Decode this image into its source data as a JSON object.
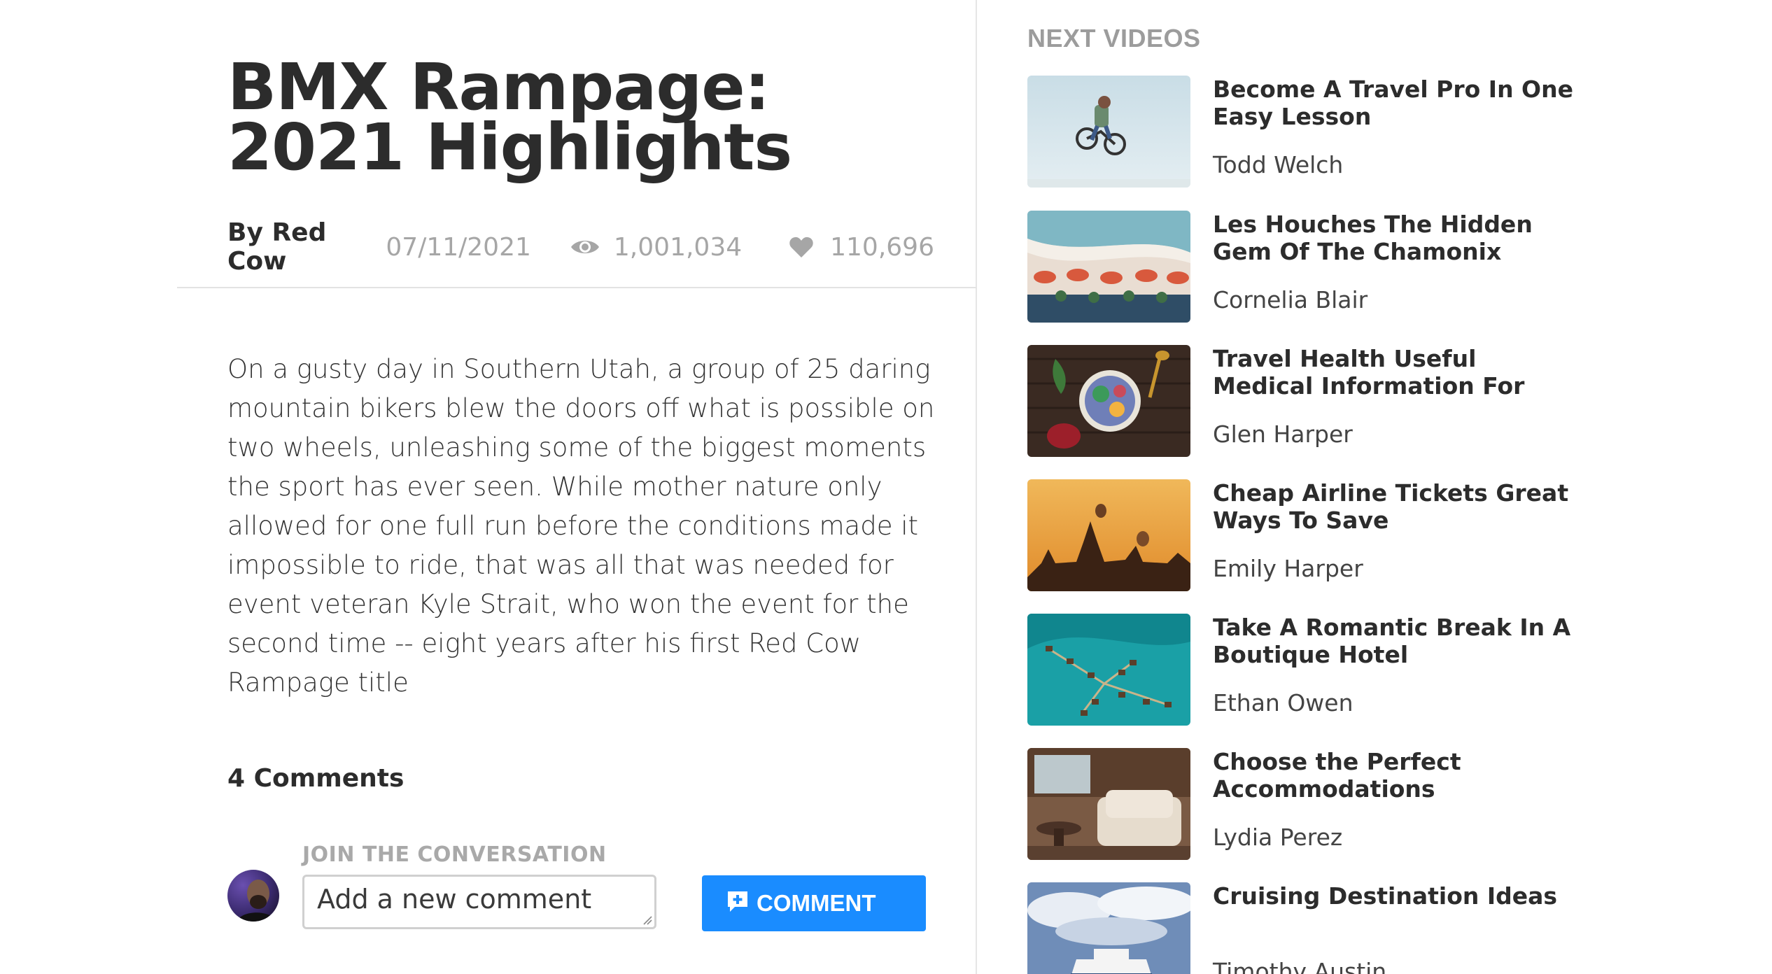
{
  "article": {
    "title": "BMX Rampage: 2021 Highlights",
    "author": "By Red Cow",
    "date": "07/11/2021",
    "views": "1,001,034",
    "likes": "110,696",
    "body": "On a gusty day in Southern Utah, a group of 25 daring mountain bikers blew the doors off what is possible on two wheels, unleashing some of the biggest moments the sport has ever seen. While mother nature only allowed for one full run before the conditions made it impossible to ride, that was all that was needed for event veteran Kyle Strait, who won the event for the second time -- eight years after his first Red Cow Rampage title",
    "icons": {
      "views": "eye-icon",
      "likes": "heart-icon"
    }
  },
  "comments": {
    "heading": "4 Comments",
    "join_label": "JOIN THE CONVERSATION",
    "input_placeholder": "Add a new comment",
    "input_value": "",
    "button_label": "COMMENT",
    "button_color": "#1a8cff"
  },
  "sidebar": {
    "heading": "NEXT VIDEOS",
    "videos": [
      {
        "title": "Become A Travel Pro In One Easy Lesson",
        "author": "Todd Welch",
        "thumb": "bmx-rider-sky"
      },
      {
        "title": "Les Houches The Hidden Gem Of The Chamonix",
        "author": "Cornelia Blair",
        "thumb": "beach-umbrellas"
      },
      {
        "title": "Travel Health Useful Medical Information For",
        "author": "Glen Harper",
        "thumb": "smoothie-bowl"
      },
      {
        "title": "Cheap Airline Tickets Great Ways To Save",
        "author": "Emily Harper",
        "thumb": "balloons-temples"
      },
      {
        "title": "Take A Romantic Break In A Boutique Hotel",
        "author": "Ethan Owen",
        "thumb": "overwater-bungalows"
      },
      {
        "title": "Choose the Perfect Accommodations",
        "author": "Lydia Perez",
        "thumb": "hotel-armchair"
      },
      {
        "title": "Cruising Destination Ideas",
        "author": "Timothy Austin",
        "thumb": "cruise-ship"
      }
    ]
  }
}
